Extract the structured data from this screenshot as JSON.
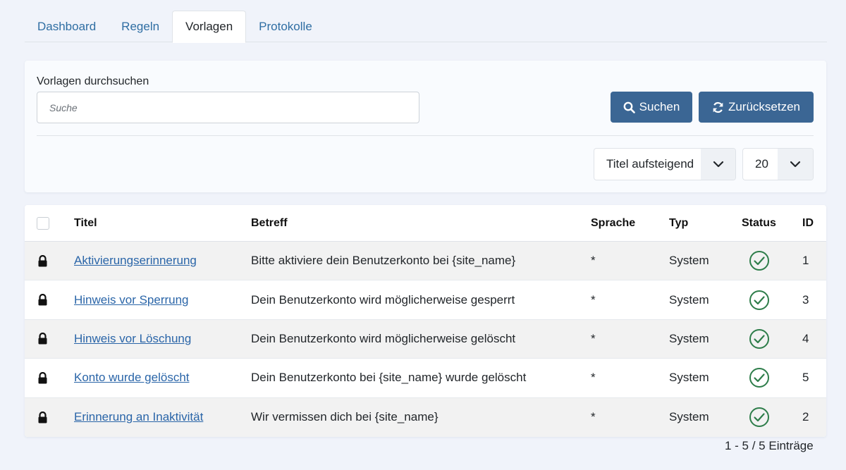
{
  "tabs": [
    {
      "label": "Dashboard"
    },
    {
      "label": "Regeln"
    },
    {
      "label": "Vorlagen"
    },
    {
      "label": "Protokolle"
    }
  ],
  "active_tab": "Vorlagen",
  "search": {
    "label": "Vorlagen durchsuchen",
    "placeholder": "Suche",
    "search_button": "Suchen",
    "reset_button": "Zurücksetzen"
  },
  "sorting": {
    "order_value": "Titel aufsteigend",
    "limit_value": "20"
  },
  "table": {
    "headers": {
      "title": "Titel",
      "subject": "Betreff",
      "language": "Sprache",
      "type": "Typ",
      "status": "Status",
      "id": "ID"
    },
    "rows": [
      {
        "title": "Aktivierungserinnerung",
        "subject": "Bitte aktiviere dein Benutzerkonto bei {site_name}",
        "language": "*",
        "type": "System",
        "id": "1"
      },
      {
        "title": "Hinweis vor Sperrung",
        "subject": "Dein Benutzerkonto wird möglicherweise gesperrt",
        "language": "*",
        "type": "System",
        "id": "3"
      },
      {
        "title": "Hinweis vor Löschung",
        "subject": "Dein Benutzerkonto wird möglicherweise gelöscht",
        "language": "*",
        "type": "System",
        "id": "4"
      },
      {
        "title": "Konto wurde gelöscht",
        "subject": "Dein Benutzerkonto bei {site_name} wurde gelöscht",
        "language": "*",
        "type": "System",
        "id": "5"
      },
      {
        "title": "Erinnerung an Inaktivität",
        "subject": "Wir vermissen dich bei {site_name}",
        "language": "*",
        "type": "System",
        "id": "2"
      }
    ]
  },
  "footer": {
    "count_text": "1 - 5 / 5 Einträge"
  },
  "colors": {
    "primary_button": "#3b6694",
    "link": "#2a65a8",
    "status_ok": "#2e7d4a",
    "background": "#f0f3fa"
  },
  "icons": {
    "row_lock": "lock-icon",
    "status": "check-circle-icon",
    "search": "search-icon",
    "reset": "refresh-icon",
    "select": "chevron-down-icon"
  }
}
